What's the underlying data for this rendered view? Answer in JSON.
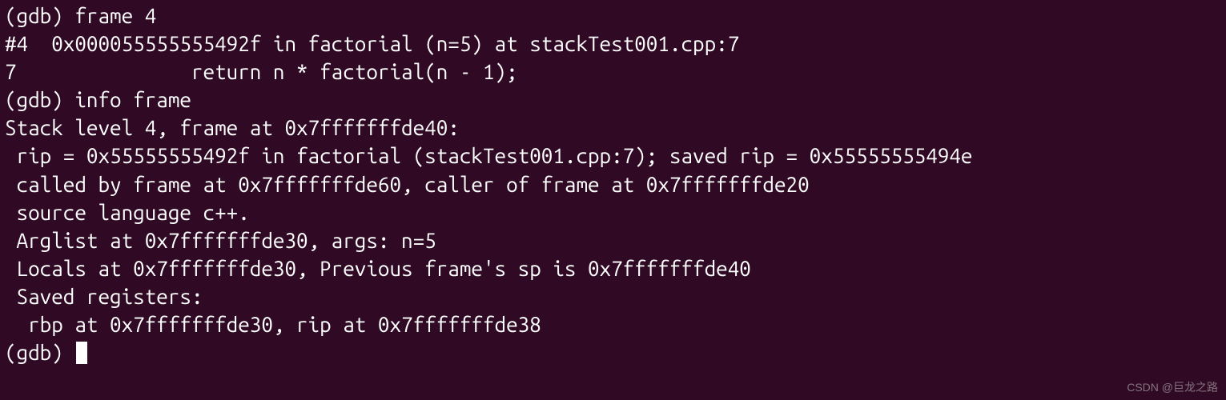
{
  "terminal": {
    "lines": [
      "(gdb) frame 4",
      "#4  0x000055555555492f in factorial (n=5) at stackTest001.cpp:7",
      "7               return n * factorial(n - 1);",
      "(gdb) info frame",
      "Stack level 4, frame at 0x7fffffffde40:",
      " rip = 0x55555555492f in factorial (stackTest001.cpp:7); saved rip = 0x55555555494e",
      " called by frame at 0x7fffffffde60, caller of frame at 0x7fffffffde20",
      " source language c++.",
      " Arglist at 0x7fffffffde30, args: n=5",
      " Locals at 0x7fffffffde30, Previous frame's sp is 0x7fffffffde40",
      " Saved registers:",
      "  rbp at 0x7fffffffde30, rip at 0x7fffffffde38"
    ],
    "prompt": "(gdb) "
  },
  "watermark": "CSDN @巨龙之路"
}
